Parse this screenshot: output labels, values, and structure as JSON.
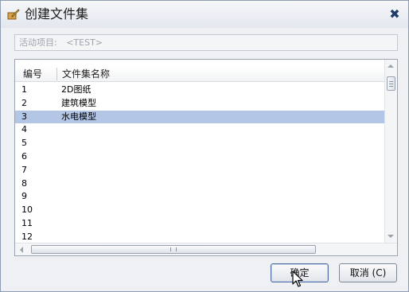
{
  "window": {
    "title": "创建文件集",
    "close_glyph": "✖"
  },
  "activity": {
    "label": "活动项目:",
    "value": "<TEST>"
  },
  "table": {
    "columns": [
      "编号",
      "文件集名称"
    ],
    "rows": [
      {
        "no": "1",
        "name": "2D图纸",
        "selected": false
      },
      {
        "no": "2",
        "name": "建筑模型",
        "selected": false
      },
      {
        "no": "3",
        "name": "水电模型",
        "selected": true
      },
      {
        "no": "4",
        "name": "",
        "selected": false
      },
      {
        "no": "5",
        "name": "",
        "selected": false
      },
      {
        "no": "6",
        "name": "",
        "selected": false
      },
      {
        "no": "7",
        "name": "",
        "selected": false
      },
      {
        "no": "8",
        "name": "",
        "selected": false
      },
      {
        "no": "9",
        "name": "",
        "selected": false
      },
      {
        "no": "10",
        "name": "",
        "selected": false
      },
      {
        "no": "11",
        "name": "",
        "selected": false
      },
      {
        "no": "12",
        "name": "",
        "selected": false
      }
    ],
    "selection_color": "#b3c6e6"
  },
  "buttons": {
    "ok_label": "确定",
    "cancel_label": "取消 (C)"
  },
  "icons": {
    "title": "pencil-folder-icon",
    "close": "close-icon",
    "cursor": "mouse-pointer-icon"
  }
}
